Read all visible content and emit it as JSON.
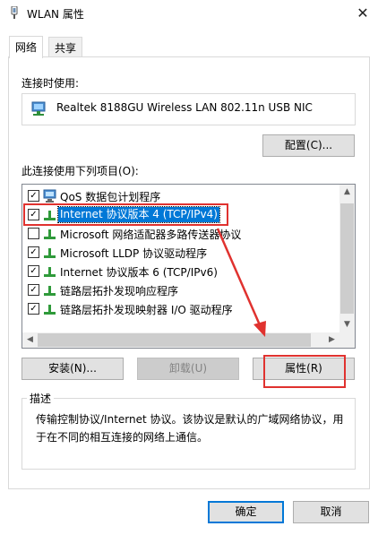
{
  "window": {
    "title": "WLAN 属性",
    "close_glyph": "✕"
  },
  "tabs": [
    {
      "label": "网络",
      "active": true
    },
    {
      "label": "共享",
      "active": false
    }
  ],
  "connect_using": {
    "label": "连接时使用:",
    "adapter_name": "Realtek 8188GU Wireless LAN 802.11n USB NIC",
    "configure_label": "配置(C)..."
  },
  "items_section": {
    "label": "此连接使用下列项目(O):",
    "items": [
      {
        "label": "QoS 数据包计划程序",
        "checked": true,
        "icon": "qos-icon",
        "selected": false
      },
      {
        "label": "Internet 协议版本 4 (TCP/IPv4)",
        "checked": true,
        "icon": "protocol-icon",
        "selected": true
      },
      {
        "label": "Microsoft 网络适配器多路传送器协议",
        "checked": false,
        "icon": "protocol-icon",
        "selected": false
      },
      {
        "label": "Microsoft LLDP 协议驱动程序",
        "checked": true,
        "icon": "protocol-icon",
        "selected": false
      },
      {
        "label": "Internet 协议版本 6 (TCP/IPv6)",
        "checked": true,
        "icon": "protocol-icon",
        "selected": false
      },
      {
        "label": "链路层拓扑发现响应程序",
        "checked": true,
        "icon": "protocol-icon",
        "selected": false
      },
      {
        "label": "链路层拓扑发现映射器 I/O 驱动程序",
        "checked": true,
        "icon": "protocol-icon",
        "selected": false
      }
    ]
  },
  "buttons": {
    "install": "安装(N)...",
    "uninstall": "卸载(U)",
    "properties": "属性(R)",
    "ok": "确定",
    "cancel": "取消"
  },
  "description": {
    "legend": "描述",
    "text": "传输控制协议/Internet 协议。该协议是默认的广域网络协议，用于在不同的相互连接的网络上通信。"
  },
  "colors": {
    "selection": "#0078d7",
    "annotation_red": "#e0322f",
    "focus_blue": "#0078d7"
  }
}
